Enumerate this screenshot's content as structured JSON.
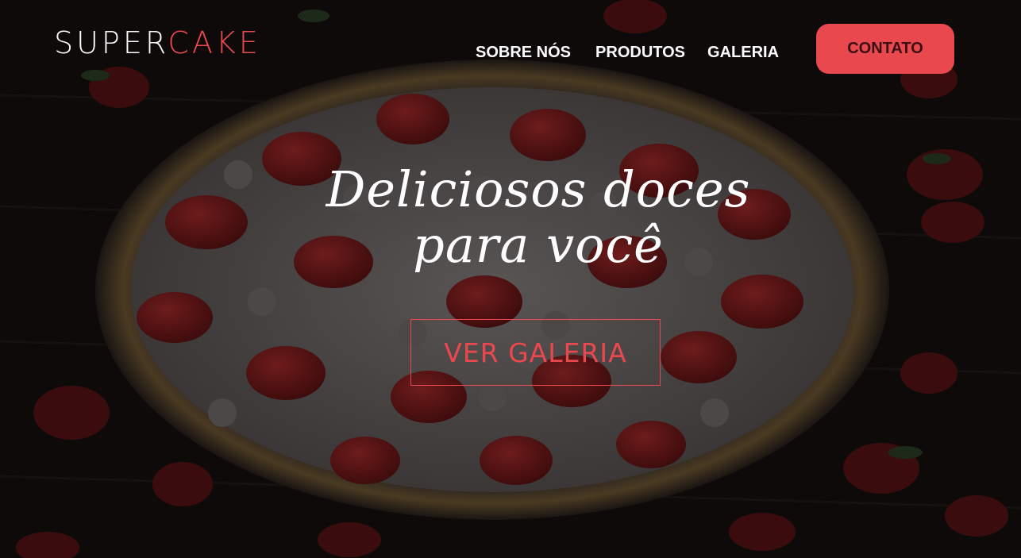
{
  "header": {
    "logo": {
      "part_a": "SUPER",
      "part_b": "CAKE"
    },
    "nav": [
      {
        "label": "SOBRE NÓS"
      },
      {
        "label": "PRODUTOS"
      },
      {
        "label": "GALERIA"
      }
    ],
    "cta_label": "CONTATO"
  },
  "hero": {
    "headline_line1": "Deliciosos doces",
    "headline_line2": "para você",
    "button_label": "VER GALERIA",
    "background_image": "strawberry-cream-tart-photo"
  },
  "colors": {
    "accent": "#e8484e",
    "text": "#ffffff",
    "background": "#0d0909"
  }
}
